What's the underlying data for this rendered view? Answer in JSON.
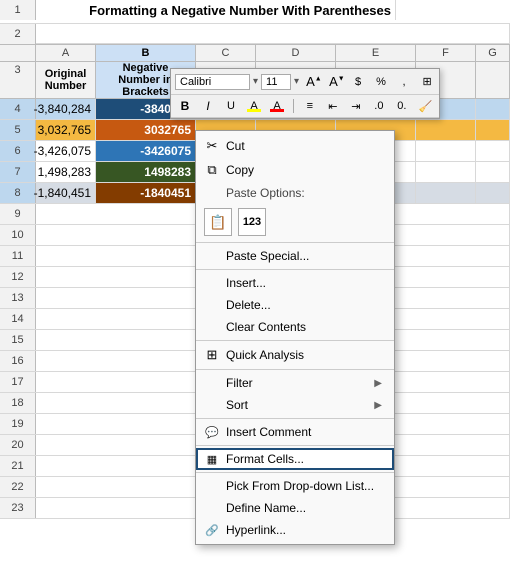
{
  "title": "Formatting a Negative Number With Parentheses",
  "columns": {
    "headers": [
      "",
      "A",
      "B",
      "C",
      "D",
      "E",
      "F",
      "G"
    ]
  },
  "header_row": {
    "row_num": "3",
    "col_a": "Original Number",
    "col_b_line1": "Negative",
    "col_b_line2": "Number in Brackets"
  },
  "data_rows": [
    {
      "row": "4",
      "col_a": "-3,840,284",
      "col_b": "-3840284",
      "style": "blue"
    },
    {
      "row": "5",
      "col_a": "3,032,765",
      "col_b": "3032765",
      "style": "orange"
    },
    {
      "row": "6",
      "col_a": "-3,426,075",
      "col_b": "-3426075",
      "style": "normal"
    },
    {
      "row": "7",
      "col_a": "1,498,283",
      "col_b": "1498283",
      "style": "selected"
    },
    {
      "row": "8",
      "col_a": "-1,840,451",
      "col_b": "-1840451",
      "style": "normal-dark"
    }
  ],
  "toolbar": {
    "font_name": "Calibri",
    "font_size": "11",
    "bold": "B",
    "italic": "I"
  },
  "context_menu": {
    "items": [
      {
        "id": "cut",
        "label": "Cut",
        "icon": "✂",
        "has_icon": true,
        "disabled": false,
        "has_arrow": false
      },
      {
        "id": "copy",
        "label": "Copy",
        "icon": "⧉",
        "has_icon": true,
        "disabled": false,
        "has_arrow": false
      },
      {
        "id": "paste-options-label",
        "label": "Paste Options:",
        "is_label": true
      },
      {
        "id": "paste-special",
        "label": "Paste Special...",
        "icon": "",
        "has_icon": false,
        "disabled": false,
        "has_arrow": false
      },
      {
        "id": "insert",
        "label": "Insert...",
        "icon": "",
        "has_icon": false,
        "disabled": false,
        "has_arrow": false
      },
      {
        "id": "delete",
        "label": "Delete...",
        "icon": "",
        "has_icon": false,
        "disabled": false,
        "has_arrow": false
      },
      {
        "id": "clear-contents",
        "label": "Clear Contents",
        "icon": "",
        "has_icon": false,
        "disabled": false,
        "has_arrow": false
      },
      {
        "id": "quick-analysis",
        "label": "Quick Analysis",
        "icon": "⊞",
        "has_icon": true,
        "disabled": false,
        "has_arrow": false
      },
      {
        "id": "filter",
        "label": "Filter",
        "icon": "",
        "has_icon": false,
        "disabled": false,
        "has_arrow": true
      },
      {
        "id": "sort",
        "label": "Sort",
        "icon": "",
        "has_icon": false,
        "disabled": false,
        "has_arrow": true
      },
      {
        "id": "insert-comment",
        "label": "Insert Comment",
        "icon": "💬",
        "has_icon": true,
        "disabled": false,
        "has_arrow": false
      },
      {
        "id": "format-cells",
        "label": "Format Cells...",
        "icon": "▦",
        "has_icon": true,
        "disabled": false,
        "has_arrow": false,
        "highlighted": true
      },
      {
        "id": "pick-dropdown",
        "label": "Pick From Drop-down List...",
        "icon": "",
        "has_icon": false,
        "disabled": false,
        "has_arrow": false
      },
      {
        "id": "define-name",
        "label": "Define Name...",
        "icon": "",
        "has_icon": false,
        "disabled": false,
        "has_arrow": false
      },
      {
        "id": "hyperlink",
        "label": "Hyperlink...",
        "icon": "🔗",
        "has_icon": true,
        "disabled": false,
        "has_arrow": false
      }
    ]
  }
}
